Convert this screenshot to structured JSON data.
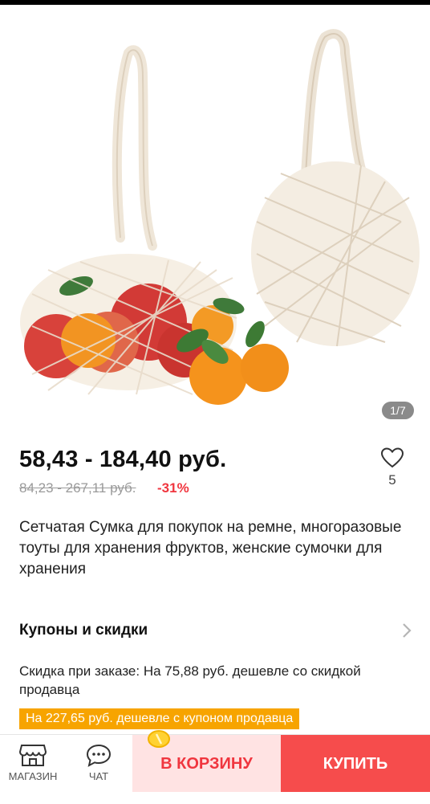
{
  "gallery": {
    "counter": "1/7"
  },
  "product": {
    "price_range": "58,43 - 184,40 руб.",
    "old_price_range": "84,23 - 267,11 руб.",
    "discount": "-31%",
    "wishlist_count": "5",
    "title": "Сетчатая Сумка для покупок на ремне, многоразовые тоуты для хранения фруктов, женские сумочки для хранения"
  },
  "coupons": {
    "title": "Купоны и скидки",
    "order_discount": "Скидка при заказе: На 75,88 руб. дешевле со скидкой продавца",
    "seller_coupon": "На 227,65 руб. дешевле с купоном продавца"
  },
  "bottom_bar": {
    "store_label": "МАГАЗИН",
    "chat_label": "ЧАТ",
    "cart_label": "В КОРЗИНУ",
    "buy_label": "КУПИТЬ"
  },
  "colors": {
    "accent": "#f0363f",
    "buy": "#f64c4c",
    "coupon": "#f7a400"
  }
}
